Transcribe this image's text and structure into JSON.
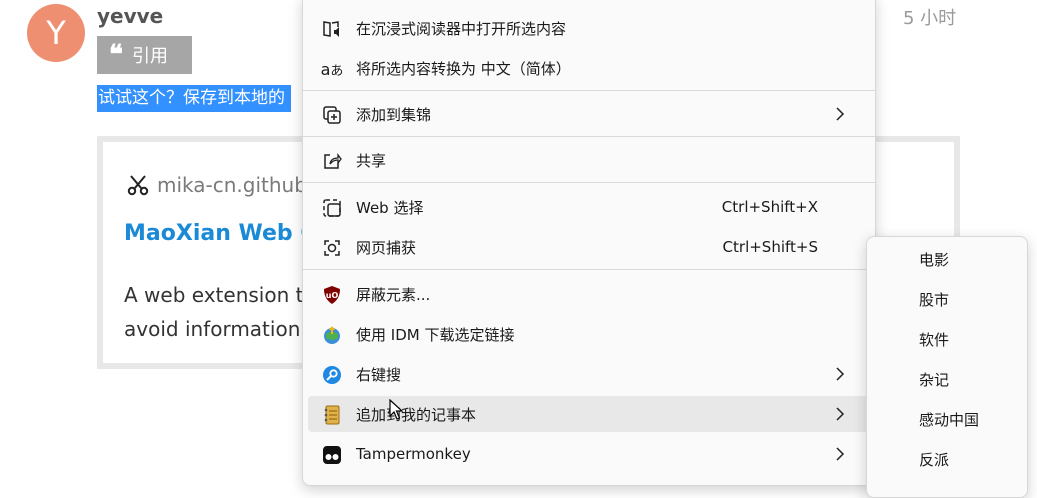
{
  "comment": {
    "avatar_letter": "Y",
    "username": "yevve",
    "timestamp": "5 小时",
    "quote_label": "引用",
    "selected_text": "试试这个？保存到本地的",
    "card": {
      "site": "mika-cn.github.",
      "title": "MaoXian Web Cl",
      "desc_line1": "A web extension to",
      "desc_line2": "avoid information i"
    }
  },
  "context_menu": {
    "items": [
      {
        "label": "在沉浸式阅读器中打开所选内容",
        "icon": "immersive-reader-icon"
      },
      {
        "label": "将所选内容转换为 中文（简体）",
        "icon": "translate-icon"
      },
      {
        "label": "添加到集锦",
        "icon": "collections-icon",
        "submenu": true
      },
      {
        "label": "共享",
        "icon": "share-icon"
      },
      {
        "label": "Web 选择",
        "icon": "web-select-icon",
        "shortcut": "Ctrl+Shift+X"
      },
      {
        "label": "网页捕获",
        "icon": "web-capture-icon",
        "shortcut": "Ctrl+Shift+S"
      },
      {
        "label": "屏蔽元素...",
        "icon": "ublock-icon"
      },
      {
        "label": "使用 IDM 下载选定链接",
        "icon": "idm-icon"
      },
      {
        "label": "右键搜",
        "icon": "search-key-icon",
        "submenu": true
      },
      {
        "label": "追加到我的记事本",
        "icon": "notebook-icon",
        "submenu": true
      },
      {
        "label": "Tampermonkey",
        "icon": "tampermonkey-icon",
        "submenu": true
      }
    ]
  },
  "submenu": {
    "items": [
      "电影",
      "股市",
      "软件",
      "杂记",
      "感动中国",
      "反派"
    ]
  },
  "colors": {
    "avatar": "#ef8f71",
    "selection": "#3390ff",
    "link_title": "#1b8ad6",
    "quote_button": "#a6a6a6",
    "menu_hover": "#e8e8e8"
  }
}
